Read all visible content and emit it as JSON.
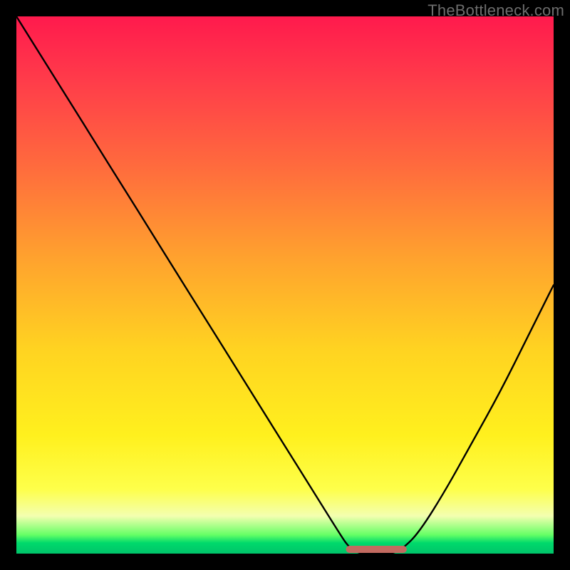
{
  "watermark": "TheBottleneck.com",
  "chart_data": {
    "type": "line",
    "title": "",
    "xlabel": "",
    "ylabel": "",
    "xlim": [
      0,
      100
    ],
    "ylim": [
      0,
      100
    ],
    "series": [
      {
        "name": "bottleneck-curve",
        "x": [
          0,
          5,
          10,
          15,
          20,
          25,
          30,
          35,
          40,
          45,
          50,
          55,
          60,
          62,
          64,
          66,
          68,
          70,
          72,
          75,
          80,
          85,
          90,
          95,
          100
        ],
        "y": [
          100,
          92,
          84,
          76,
          68,
          60,
          52,
          44,
          36,
          28,
          20,
          12,
          4,
          1,
          0,
          0,
          0,
          0,
          1,
          4,
          12,
          21,
          30,
          40,
          50
        ]
      },
      {
        "name": "highlight-floor",
        "x": [
          62,
          72
        ],
        "y": [
          0,
          0
        ]
      }
    ],
    "colors": {
      "curve": "#000000",
      "highlight": "#c36a60"
    }
  }
}
